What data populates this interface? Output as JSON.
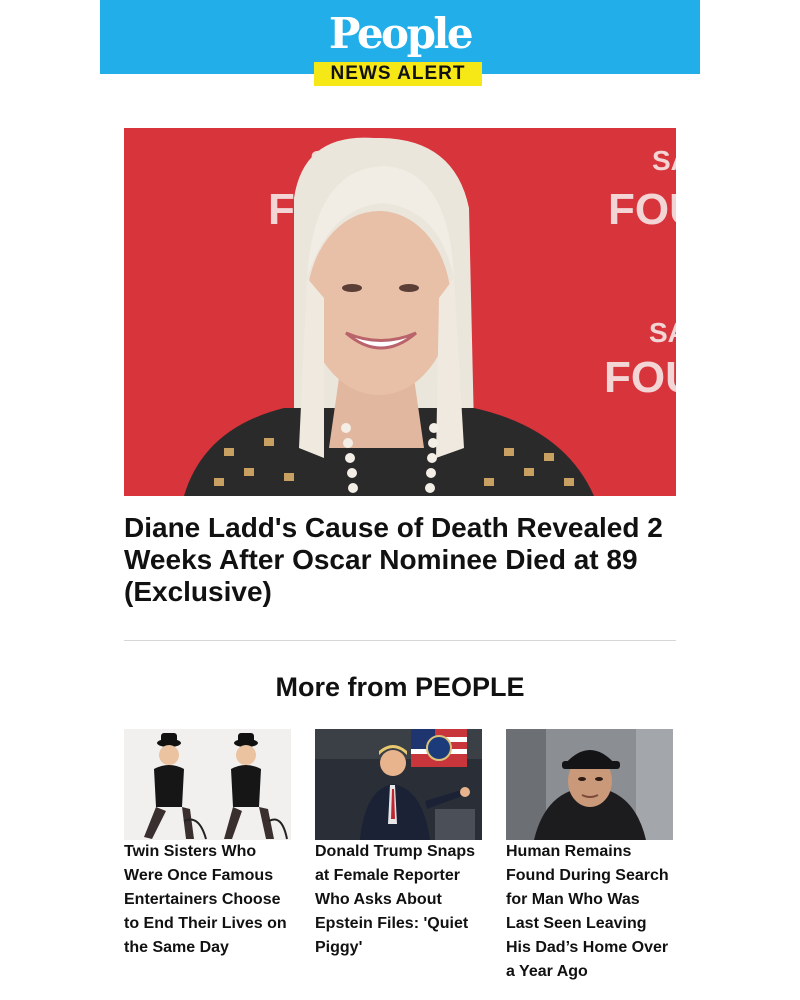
{
  "brand": {
    "logo_text": "People",
    "badge_text": "NEWS ALERT",
    "header_color": "#22aee8",
    "badge_color": "#f6e716"
  },
  "hero": {
    "image_alt": "Photo of Diane Ladd smiling in front of a red backdrop",
    "backdrop_letters_top": "SA",
    "backdrop_word": "FOUN",
    "headline": "Diane Ladd's Cause of Death Revealed 2 Weeks After Oscar Nominee Died at 89 (Exclusive)"
  },
  "more": {
    "title": "More from PEOPLE",
    "articles": [
      {
        "image_alt": "Two women in black costumes and bowler hats posing",
        "caption": "Twin Sisters Who Were Once Famous Entertainers Choose to End Their Lives on the Same Day"
      },
      {
        "image_alt": "Donald Trump speaking aboard an airplane",
        "caption": "Donald Trump Snaps at Female Reporter Who Asks About Epstein Files: 'Quiet Piggy'"
      },
      {
        "image_alt": "Young man in a black cap and hoodie in a car",
        "caption": "Human Remains Found During Search for Man Who Was Last Seen Leaving His Dad’s Home Over a Year Ago"
      }
    ]
  }
}
